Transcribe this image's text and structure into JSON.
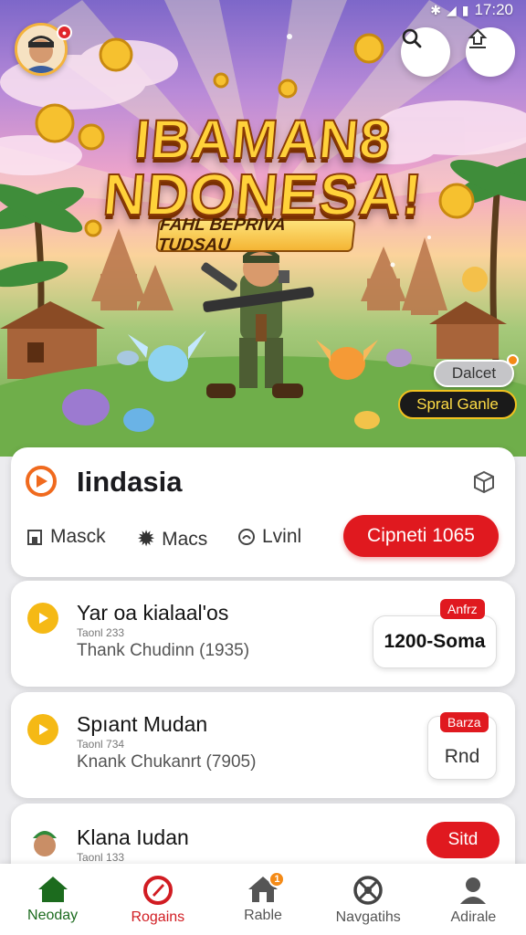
{
  "status_bar": {
    "time": "17:20",
    "icons": [
      "bluetooth-icon",
      "signal-icon",
      "battery-icon"
    ]
  },
  "hero": {
    "title_line1": "IBAMAN8",
    "title_line2": "NDONESA!",
    "subtitle": "FAHL BEPRIVA TUDSAU",
    "pill_small": "Dalcet",
    "pill_feature": "Spral Ganle"
  },
  "main_card": {
    "title": "Iindasia",
    "meta": [
      {
        "icon": "store-icon",
        "label": "Masck"
      },
      {
        "icon": "gear-icon",
        "label": "Macs"
      },
      {
        "icon": "signal-at-icon",
        "label": "Lvinl"
      }
    ],
    "cta_label": "Cipneti 1065"
  },
  "list": [
    {
      "title": "Yar oa kialaal'os",
      "code": "Taonl 233",
      "subtitle": "Thank Chudinn (1935)",
      "tag": "Anfrz",
      "price": "1200-Soma"
    },
    {
      "title": "Spıant Mudan",
      "code": "Taonl 734",
      "subtitle": "Knank Chukanrt (7905)",
      "tag": "Barza",
      "action": "Rnd"
    },
    {
      "title": "Klana Iudan",
      "code": "Taonl 133",
      "action": "Sitd"
    }
  ],
  "nav": [
    {
      "label": "Neoday",
      "icon": "home-icon",
      "state": "active"
    },
    {
      "label": "Rogains",
      "icon": "rocket-icon",
      "state": "highlighted"
    },
    {
      "label": "Rable",
      "icon": "house-icon",
      "badge": "1"
    },
    {
      "label": "Navgatihs",
      "icon": "compass-icon"
    },
    {
      "label": "Adirale",
      "icon": "profile-icon"
    }
  ],
  "colors": {
    "accent": "#e0191f",
    "active_nav": "#1c6b1e",
    "play_orange": "#f06a1e",
    "play_yellow": "#f5b915",
    "gold": "#ffd23a"
  }
}
